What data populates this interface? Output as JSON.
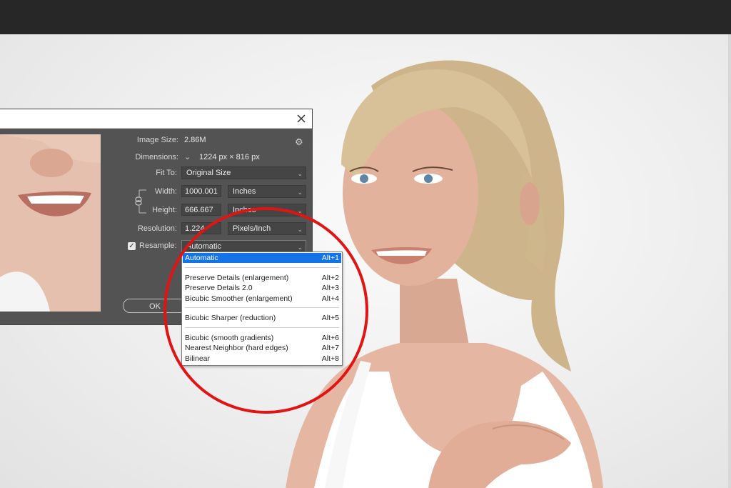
{
  "dialog": {
    "image_size_label": "Image Size:",
    "image_size_value": "2.86M",
    "dimensions_label": "Dimensions:",
    "dimensions_value": "1224 px  ×  816 px",
    "fit_to_label": "Fit To:",
    "fit_to_value": "Original Size",
    "width_label": "Width:",
    "width_value": "1000.001",
    "width_unit": "Inches",
    "height_label": "Height:",
    "height_value": "666.667",
    "height_unit": "Inches",
    "resolution_label": "Resolution:",
    "resolution_value": "1.224",
    "resolution_unit": "Pixels/Inch",
    "resample_label": "Resample:",
    "resample_checked": true,
    "resample_value": "Automatic",
    "ok_label": "OK"
  },
  "resample_menu": {
    "groups": [
      [
        {
          "label": "Automatic",
          "shortcut": "Alt+1",
          "selected": true
        }
      ],
      [
        {
          "label": "Preserve Details (enlargement)",
          "shortcut": "Alt+2"
        },
        {
          "label": "Preserve Details 2.0",
          "shortcut": "Alt+3"
        },
        {
          "label": "Bicubic Smoother (enlargement)",
          "shortcut": "Alt+4"
        }
      ],
      [
        {
          "label": "Bicubic Sharper (reduction)",
          "shortcut": "Alt+5"
        }
      ],
      [
        {
          "label": "Bicubic (smooth gradients)",
          "shortcut": "Alt+6"
        },
        {
          "label": "Nearest Neighbor (hard edges)",
          "shortcut": "Alt+7"
        },
        {
          "label": "Bilinear",
          "shortcut": "Alt+8"
        }
      ]
    ]
  },
  "colors": {
    "highlight_circle": "#e11414",
    "menu_selection": "#1473e6",
    "dialog_bg": "#535353"
  }
}
